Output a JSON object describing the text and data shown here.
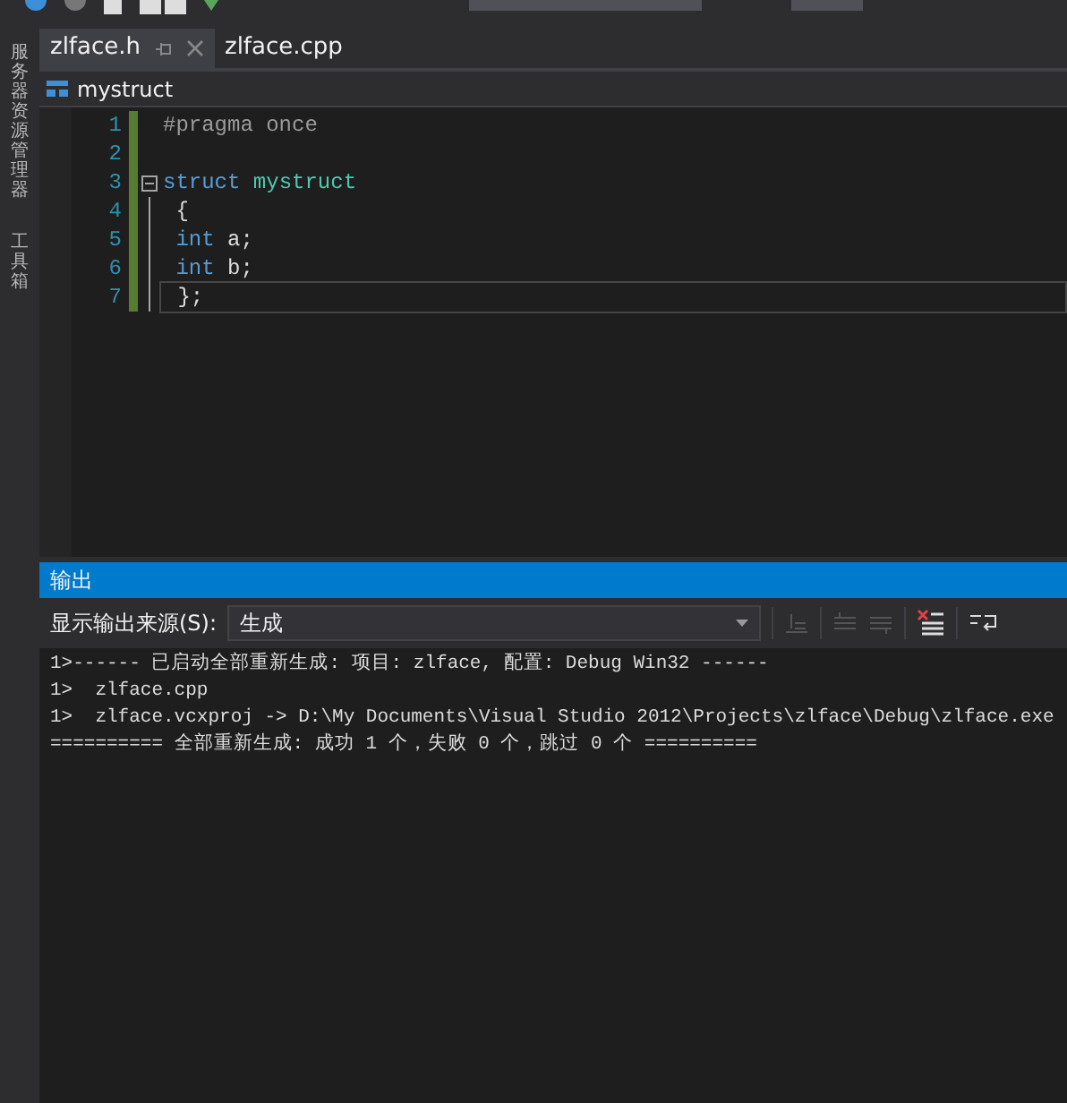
{
  "side_tabs": [
    {
      "label": "服务器资源管理器"
    },
    {
      "label": "工具箱"
    }
  ],
  "doc_tabs": [
    {
      "label": "zlface.h",
      "selected": true
    },
    {
      "label": "zlface.cpp",
      "selected": false
    }
  ],
  "nav_bar": {
    "member": "mystruct"
  },
  "code_lines": [
    {
      "number": "1",
      "tokens": [
        {
          "kind": "preprocessor",
          "text": "#pragma once"
        }
      ],
      "collapsible": false,
      "current": false
    },
    {
      "number": "2",
      "collapsible": false,
      "current": false
    },
    {
      "number": "3",
      "tokens": [
        {
          "kind": "keyword",
          "text": "struct "
        },
        {
          "kind": "type",
          "text": "mystruct"
        }
      ],
      "collapsible": true,
      "current": false
    },
    {
      "number": "4",
      "tokens": [
        {
          "kind": "plain",
          "text": " {"
        }
      ],
      "collapsible": false,
      "current": false
    },
    {
      "number": "5",
      "tokens": [
        {
          "kind": "keyword",
          "text": " int"
        },
        {
          "kind": "plain",
          "text": " a;"
        }
      ],
      "collapsible": false,
      "current": false
    },
    {
      "number": "6",
      "tokens": [
        {
          "kind": "keyword",
          "text": " int"
        },
        {
          "kind": "plain",
          "text": " b;"
        }
      ],
      "collapsible": false,
      "current": false
    },
    {
      "number": "7",
      "tokens": [
        {
          "kind": "plain",
          "text": " };"
        }
      ],
      "collapsible": false,
      "current": true
    }
  ],
  "output_panel": {
    "title": "输出",
    "source_label": "显示输出来源(S):",
    "source_value": "生成",
    "lines": [
      "1>------ 已启动全部重新生成: 项目: zlface, 配置: Debug Win32 ------",
      "1>  zlface.cpp",
      "1>  zlface.vcxproj -> D:\\My Documents\\Visual Studio 2012\\Projects\\zlface\\Debug\\zlface.exe",
      "========== 全部重新生成: 成功 1 个，失败 0 个，跳过 0 个 =========="
    ]
  }
}
